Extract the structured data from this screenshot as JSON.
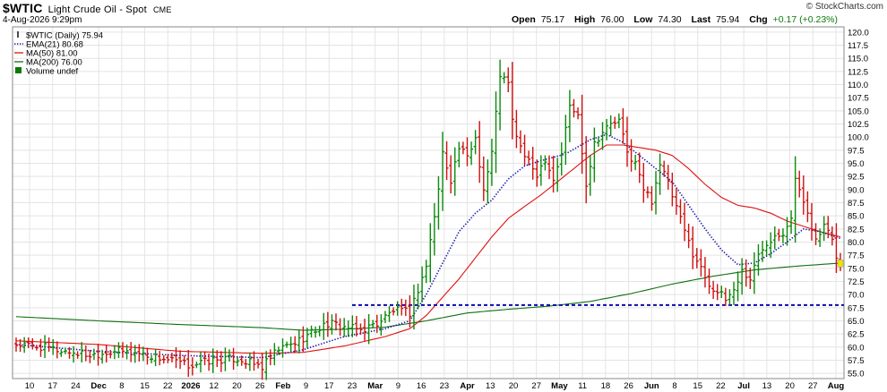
{
  "header": {
    "symbol": "$WTIC",
    "description": "Light Crude Oil - Spot",
    "exchange": "CME",
    "date": "4-Aug-2026 9:29pm",
    "brand": "© StockCharts.com",
    "quote": {
      "open_label": "Open",
      "open": "75.17",
      "high_label": "High",
      "high": "76.00",
      "low_label": "Low",
      "low": "74.30",
      "last_label": "Last",
      "last": "75.94",
      "chg_label": "Chg",
      "chg": "+0.17 (+0.23%)"
    }
  },
  "legend": [
    {
      "marker": "bar",
      "text": "$WTIC (Daily) 75.94",
      "color": "#000000"
    },
    {
      "marker": "dotted",
      "text": "EMA(21) 80.68",
      "color": "#1a1aaa"
    },
    {
      "marker": "line",
      "text": "MA(50) 81.00",
      "color": "#e01010"
    },
    {
      "marker": "line",
      "text": "MA(200) 76.00",
      "color": "#107010"
    },
    {
      "marker": "block",
      "text": "Volume undef",
      "color": "#0a7a0a"
    }
  ],
  "colors": {
    "up": "#0a8a0a",
    "down": "#d01010",
    "ema": "#1a1aaa",
    "ma50": "#e01010",
    "ma200": "#107010",
    "support": "#0a0aaa",
    "grid": "#e4e4e4",
    "last_price": "#e6e600"
  },
  "chart_data": {
    "type": "ohlc",
    "title": "$WTIC Light Crude Oil - Spot",
    "ylim": [
      54,
      121
    ],
    "y_ticks": [
      "55.0",
      "57.5",
      "60.0",
      "62.5",
      "65.0",
      "67.5",
      "70.0",
      "72.5",
      "75.0",
      "77.5",
      "80.0",
      "82.5",
      "85.0",
      "87.5",
      "90.0",
      "92.5",
      "95.0",
      "97.5",
      "100.0",
      "102.5",
      "105.0",
      "107.5",
      "110.0",
      "112.5",
      "115.0",
      "117.5",
      "120.0"
    ],
    "x_ticks": [
      {
        "label": "10",
        "bold": false
      },
      {
        "label": "17",
        "bold": false
      },
      {
        "label": "24",
        "bold": false
      },
      {
        "label": "Dec",
        "bold": true
      },
      {
        "label": "8",
        "bold": false
      },
      {
        "label": "15",
        "bold": false
      },
      {
        "label": "22",
        "bold": false
      },
      {
        "label": "2026",
        "bold": true
      },
      {
        "label": "12",
        "bold": false
      },
      {
        "label": "20",
        "bold": false
      },
      {
        "label": "26",
        "bold": false
      },
      {
        "label": "Feb",
        "bold": true
      },
      {
        "label": "9",
        "bold": false
      },
      {
        "label": "17",
        "bold": false
      },
      {
        "label": "23",
        "bold": false
      },
      {
        "label": "Mar",
        "bold": true
      },
      {
        "label": "9",
        "bold": false
      },
      {
        "label": "16",
        "bold": false
      },
      {
        "label": "23",
        "bold": false
      },
      {
        "label": "Apr",
        "bold": true
      },
      {
        "label": "13",
        "bold": false
      },
      {
        "label": "20",
        "bold": false
      },
      {
        "label": "27",
        "bold": false
      },
      {
        "label": "May",
        "bold": true
      },
      {
        "label": "11",
        "bold": false
      },
      {
        "label": "18",
        "bold": false
      },
      {
        "label": "26",
        "bold": false
      },
      {
        "label": "Jun",
        "bold": true
      },
      {
        "label": "8",
        "bold": false
      },
      {
        "label": "15",
        "bold": false
      },
      {
        "label": "22",
        "bold": false
      },
      {
        "label": "Jul",
        "bold": true
      },
      {
        "label": "13",
        "bold": false
      },
      {
        "label": "20",
        "bold": false
      },
      {
        "label": "27",
        "bold": false
      },
      {
        "label": "Aug",
        "bold": true
      }
    ],
    "support_level": 68.0,
    "price_anchors": [
      [
        0,
        60.5
      ],
      [
        6,
        60.0
      ],
      [
        12,
        59.2
      ],
      [
        18,
        58.5
      ],
      [
        24,
        59.3
      ],
      [
        30,
        58.8
      ],
      [
        36,
        57.8
      ],
      [
        42,
        56.5
      ],
      [
        48,
        57.5
      ],
      [
        54,
        57.8
      ],
      [
        60,
        56.2
      ],
      [
        64,
        59.5
      ],
      [
        68,
        60.8
      ],
      [
        72,
        62.8
      ],
      [
        76,
        64.5
      ],
      [
        80,
        63.8
      ],
      [
        84,
        63.2
      ],
      [
        88,
        64.5
      ],
      [
        92,
        67.0
      ],
      [
        96,
        66.5
      ],
      [
        98,
        71.0
      ],
      [
        100,
        75.5
      ],
      [
        102,
        85.0
      ],
      [
        103,
        90.0
      ],
      [
        104,
        97.0
      ],
      [
        106,
        92.0
      ],
      [
        108,
        98.0
      ],
      [
        110,
        96.0
      ],
      [
        112,
        100.0
      ],
      [
        114,
        90.0
      ],
      [
        116,
        97.0
      ],
      [
        118,
        112.0
      ],
      [
        120,
        110.0
      ],
      [
        121,
        103.0
      ],
      [
        123,
        98.0
      ],
      [
        125,
        95.0
      ],
      [
        127,
        93.0
      ],
      [
        129,
        96.0
      ],
      [
        131,
        92.0
      ],
      [
        133,
        97.0
      ],
      [
        135,
        106.0
      ],
      [
        137,
        104.0
      ],
      [
        139,
        91.0
      ],
      [
        141,
        99.0
      ],
      [
        143,
        101.0
      ],
      [
        145,
        102.5
      ],
      [
        147,
        103.0
      ],
      [
        149,
        97.0
      ],
      [
        151,
        95.0
      ],
      [
        153,
        90.0
      ],
      [
        155,
        88.0
      ],
      [
        157,
        95.0
      ],
      [
        159,
        91.0
      ],
      [
        161,
        86.5
      ],
      [
        163,
        82.0
      ],
      [
        165,
        78.0
      ],
      [
        167,
        75.0
      ],
      [
        169,
        72.0
      ],
      [
        171,
        70.5
      ],
      [
        173,
        69.0
      ],
      [
        175,
        71.0
      ],
      [
        177,
        74.5
      ],
      [
        179,
        73.0
      ],
      [
        181,
        77.5
      ],
      [
        183,
        80.0
      ],
      [
        185,
        81.5
      ],
      [
        187,
        82.0
      ],
      [
        189,
        85.0
      ],
      [
        190,
        92.0
      ],
      [
        191,
        89.5
      ],
      [
        193,
        86.0
      ],
      [
        195,
        80.0
      ],
      [
        197,
        83.0
      ],
      [
        199,
        80.0
      ],
      [
        200,
        77.5
      ],
      [
        201,
        75.5
      ]
    ],
    "ema21_anchors": [
      [
        0,
        60.5
      ],
      [
        20,
        59.2
      ],
      [
        40,
        58.4
      ],
      [
        60,
        58.0
      ],
      [
        70,
        59.5
      ],
      [
        80,
        62.0
      ],
      [
        90,
        63.5
      ],
      [
        96,
        65.0
      ],
      [
        100,
        70.0
      ],
      [
        104,
        76.0
      ],
      [
        108,
        82.0
      ],
      [
        112,
        85.5
      ],
      [
        116,
        88.0
      ],
      [
        120,
        92.0
      ],
      [
        124,
        94.5
      ],
      [
        128,
        95.5
      ],
      [
        134,
        96.8
      ],
      [
        140,
        99.5
      ],
      [
        144,
        100.5
      ],
      [
        148,
        99.0
      ],
      [
        152,
        96.5
      ],
      [
        156,
        94.0
      ],
      [
        160,
        91.5
      ],
      [
        164,
        87.0
      ],
      [
        168,
        82.5
      ],
      [
        172,
        78.5
      ],
      [
        176,
        75.7
      ],
      [
        180,
        76.0
      ],
      [
        184,
        77.8
      ],
      [
        188,
        80.0
      ],
      [
        192,
        82.5
      ],
      [
        196,
        82.0
      ],
      [
        201,
        80.7
      ]
    ],
    "ma50_anchors": [
      [
        0,
        61.2
      ],
      [
        20,
        60.5
      ],
      [
        40,
        59.2
      ],
      [
        60,
        58.8
      ],
      [
        70,
        59.0
      ],
      [
        80,
        60.2
      ],
      [
        90,
        62.0
      ],
      [
        96,
        63.5
      ],
      [
        100,
        66.0
      ],
      [
        104,
        69.5
      ],
      [
        108,
        73.0
      ],
      [
        112,
        77.0
      ],
      [
        116,
        81.0
      ],
      [
        120,
        84.5
      ],
      [
        124,
        86.8
      ],
      [
        128,
        89.0
      ],
      [
        132,
        91.5
      ],
      [
        136,
        94.0
      ],
      [
        140,
        96.5
      ],
      [
        144,
        98.5
      ],
      [
        148,
        98.5
      ],
      [
        152,
        98.0
      ],
      [
        156,
        97.5
      ],
      [
        160,
        96.5
      ],
      [
        164,
        94.0
      ],
      [
        168,
        91.0
      ],
      [
        172,
        88.5
      ],
      [
        176,
        87.0
      ],
      [
        180,
        86.5
      ],
      [
        184,
        85.5
      ],
      [
        188,
        84.0
      ],
      [
        192,
        83.0
      ],
      [
        196,
        82.0
      ],
      [
        201,
        81.0
      ]
    ],
    "ma200_anchors": [
      [
        0,
        65.8
      ],
      [
        20,
        65.0
      ],
      [
        40,
        64.3
      ],
      [
        60,
        63.7
      ],
      [
        70,
        63.2
      ],
      [
        80,
        63.4
      ],
      [
        90,
        63.8
      ],
      [
        100,
        65.0
      ],
      [
        110,
        66.5
      ],
      [
        120,
        67.2
      ],
      [
        130,
        67.8
      ],
      [
        140,
        68.7
      ],
      [
        150,
        70.2
      ],
      [
        160,
        72.0
      ],
      [
        170,
        73.5
      ],
      [
        180,
        74.7
      ],
      [
        190,
        75.4
      ],
      [
        201,
        76.0
      ]
    ]
  }
}
